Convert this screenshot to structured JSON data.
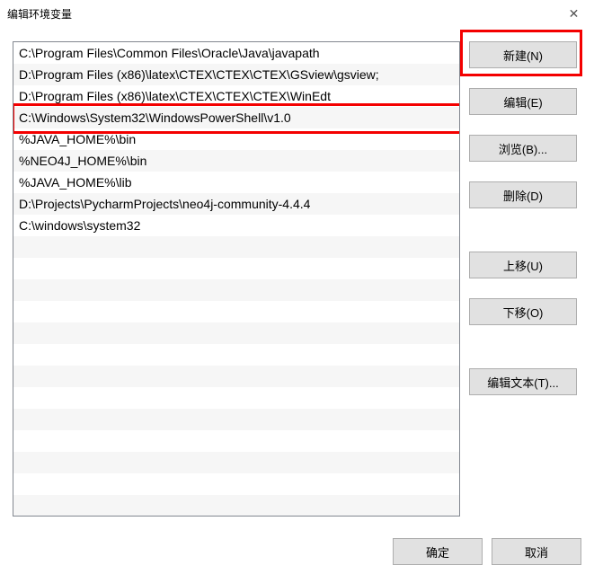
{
  "window": {
    "title": "编辑环境变量"
  },
  "list": {
    "items": [
      "C:\\Program Files\\Common Files\\Oracle\\Java\\javapath",
      "D:\\Program Files (x86)\\latex\\CTEX\\CTEX\\CTEX\\GSview\\gsview;",
      "D:\\Program Files (x86)\\latex\\CTEX\\CTEX\\CTEX\\WinEdt",
      "C:\\Windows\\System32\\WindowsPowerShell\\v1.0",
      "%JAVA_HOME%\\bin",
      "%NEO4J_HOME%\\bin",
      "%JAVA_HOME%\\lib",
      "D:\\Projects\\PycharmProjects\\neo4j-community-4.4.4",
      "C:\\windows\\system32"
    ],
    "highlighted_index": 3
  },
  "buttons": {
    "new": "新建(N)",
    "edit": "编辑(E)",
    "browse": "浏览(B)...",
    "delete": "删除(D)",
    "move_up": "上移(U)",
    "move_down": "下移(O)",
    "edit_text": "编辑文本(T)...",
    "ok": "确定",
    "cancel": "取消"
  },
  "annotations": {
    "highlight_button": "new",
    "highlight_row_index": 3
  }
}
